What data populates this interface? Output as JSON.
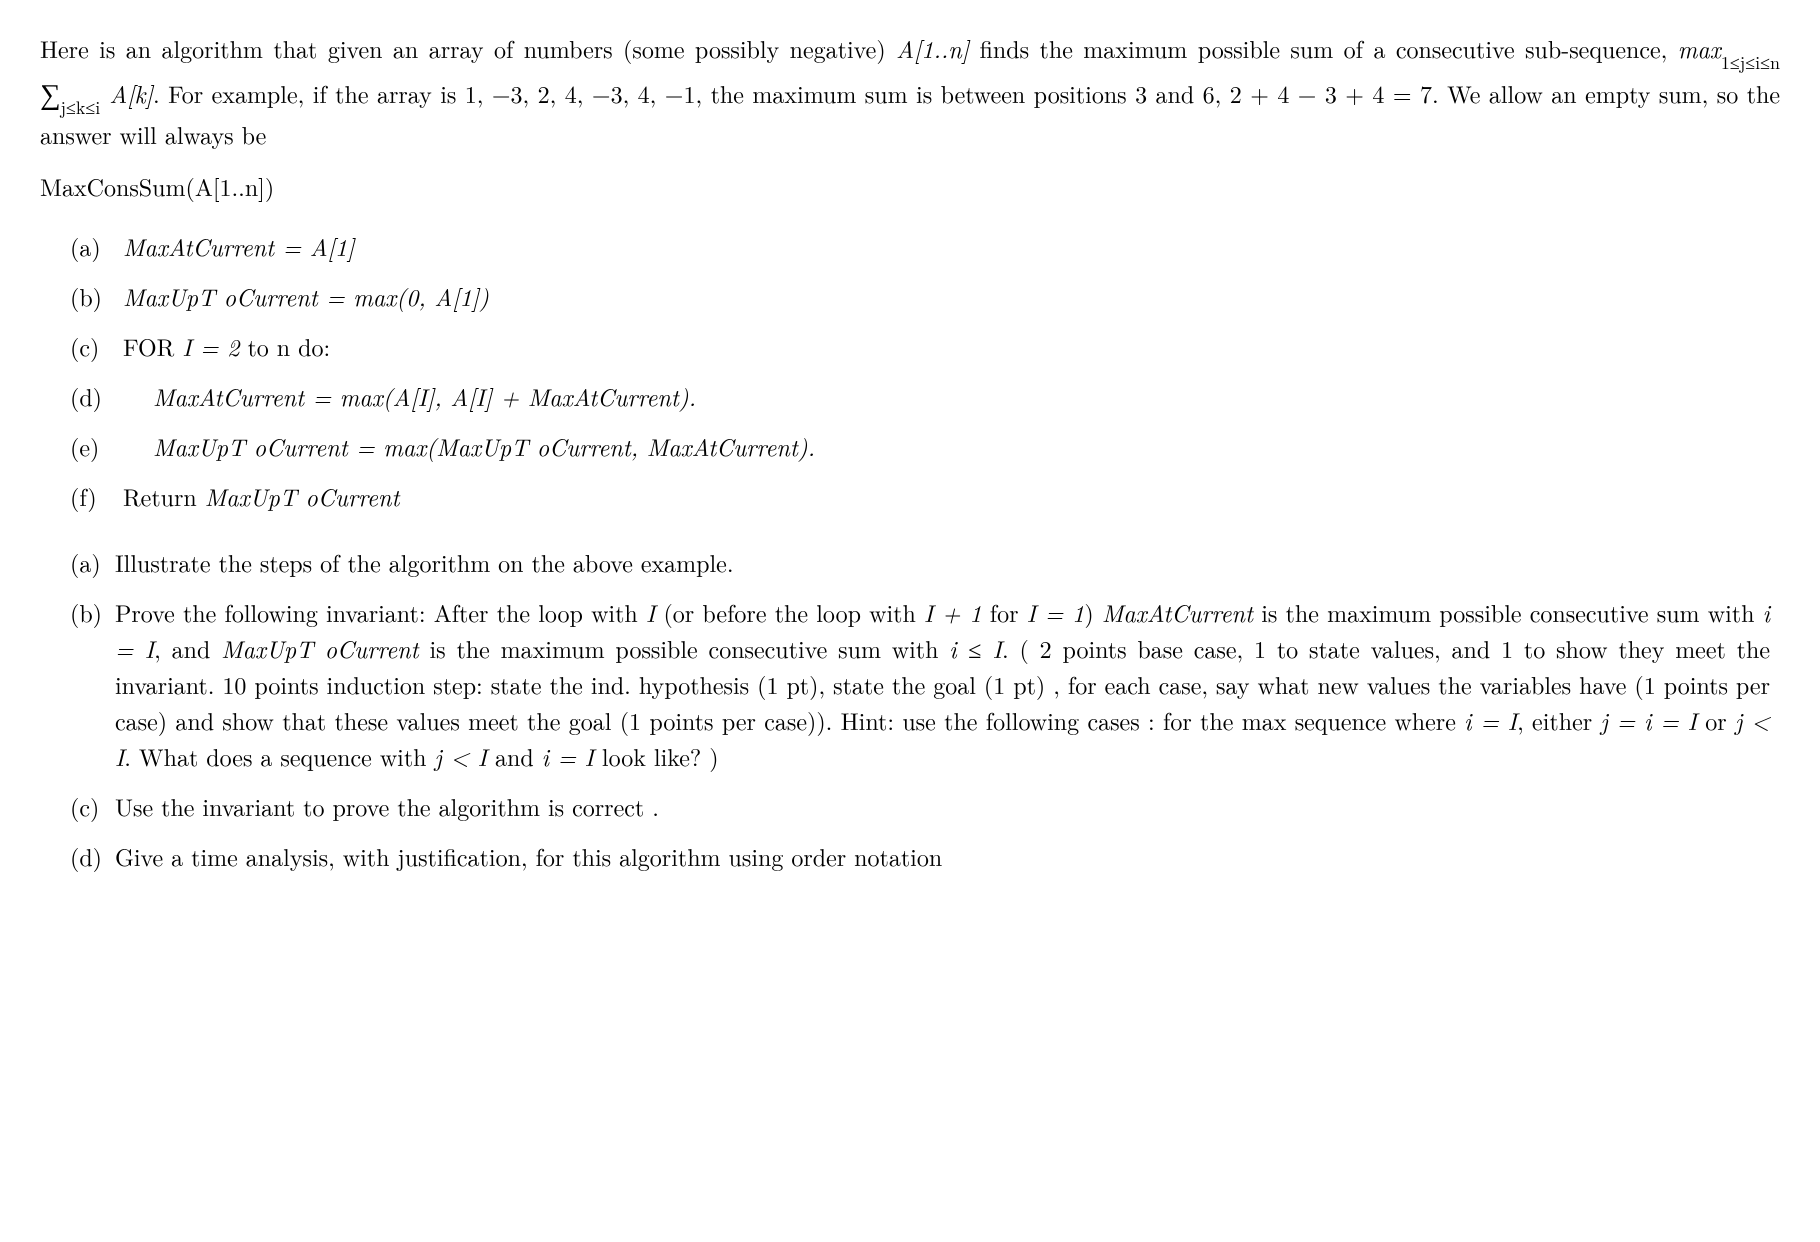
{
  "intro_part1": "Here is an algorithm that given an array of numbers (some possibly negative) ",
  "intro_arr": "A[1..n]",
  "intro_part2": " finds the maximum possible sum of a consecutive sub-sequence, ",
  "intro_max_prefix": "max",
  "intro_max_sub": "1≤j≤i≤n",
  "intro_sum_sub": "j≤k≤i",
  "intro_Ak": " A[k]",
  "intro_part3": ". For example, if the array is 1, −3, 2, 4, −3, 4, −1, the maximum sum is between positions 3 and 6, 2 + 4 − 3 + 4 = 7. We allow an empty sum, so the answer will always be",
  "funcname": "MaxConsSum(A[1..n])",
  "algo": {
    "a": {
      "label": "(a)",
      "text": "MaxAtCurrent = A[1]"
    },
    "b": {
      "label": "(b)",
      "text": "MaxUpT oCurrent = max(0, A[1])"
    },
    "c": {
      "label": "(c)",
      "text_pre": "FOR ",
      "text_mid": "I = 2",
      "text_post": " to n do:"
    },
    "d": {
      "label": "(d)",
      "text": "MaxAtCurrent = max(A[I], A[I] + MaxAtCurrent)."
    },
    "e": {
      "label": "(e)",
      "text": "MaxUpT oCurrent = max(MaxUpT oCurrent, MaxAtCurrent)."
    },
    "f": {
      "label": "(f)",
      "text_pre": "Return ",
      "text_var": "MaxUpT oCurrent"
    }
  },
  "questions": {
    "a": {
      "label": "(a)",
      "text": "Illustrate the steps of the algorithm on the above example."
    },
    "b": {
      "label": "(b)",
      "p1": "Prove the following invariant: After the loop with ",
      "v1": "I",
      "p2": " (or before the loop with ",
      "v2": "I + 1",
      "p3": " for ",
      "v3": "I = 1",
      "p4": ") ",
      "v4": "MaxAtCurrent",
      "p5": " is the maximum possible consecutive sum with ",
      "v5": "i = I",
      "p6": ", and ",
      "v6": "MaxUpT oCurrent",
      "p7": " is the maximum possible consecutive sum with ",
      "v7": "i ≤ I",
      "p8": ". ( 2 points base case, 1 to state values, and 1 to show they meet the invariant. 10 points induction step: state the ind. hypothesis (1 pt), state the goal (1 pt) , for each case, say what new values the variables have (1 points per case) and show that these values meet the goal (1 points per case)). Hint: use the following cases : for the max sequence where ",
      "v8": "i = I",
      "p9": ", either ",
      "v9": "j = i = I",
      "p10": " or ",
      "v10": "j < I",
      "p11": ". What does a sequence with ",
      "v11": "j < I",
      "p12": " and ",
      "v12": "i = I",
      "p13": " look like? )"
    },
    "c": {
      "label": "(c)",
      "text": "Use the invariant to prove the algorithm is correct ."
    },
    "d": {
      "label": "(d)",
      "text": "Give a time analysis, with justification, for this algorithm using order notation"
    }
  }
}
